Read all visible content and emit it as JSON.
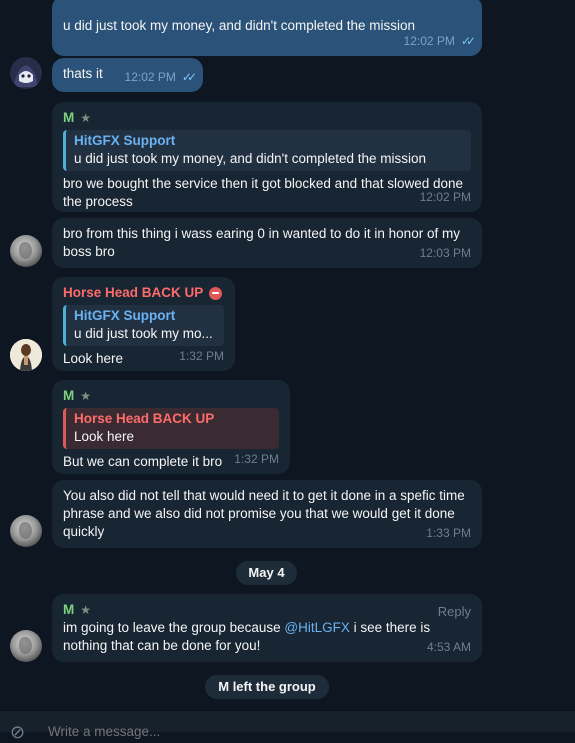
{
  "messages": [
    {
      "text": "u did just took my money, and didn't completed the mission",
      "time": "12:02 PM"
    },
    {
      "text": "thats it",
      "time": "12:02 PM"
    },
    {
      "sender": "M",
      "quote": {
        "name": "HitGFX Support",
        "text": "u did just took my money, and didn't completed the mission"
      },
      "text": "bro we bought the service then it got blocked and that slowed done the process",
      "time": "12:02 PM"
    },
    {
      "text": "bro from this thing i wass earing 0 in wanted to do it in honor of my boss bro",
      "time": "12:03 PM"
    },
    {
      "sender": "Horse Head BACK UP",
      "quote": {
        "name": "HitGFX Support",
        "text": "u did just took my mo..."
      },
      "text": "Look here",
      "time": "1:32 PM"
    },
    {
      "sender": "M",
      "quote": {
        "name": "Horse Head BACK UP",
        "text": "Look here"
      },
      "text": "But we can complete it bro",
      "time": "1:32 PM"
    },
    {
      "text": "You also did not tell that would need it to get it done in a spefic time phrase and we also did not promise you that we would get it done quickly",
      "time": "1:33 PM"
    },
    {
      "sender": "M",
      "reply_label": "Reply",
      "text_before": "im going to leave the group because ",
      "mention": "@HitLGFX",
      "text_after": " i see there  is nothing that can be done for you!",
      "time": "4:53 AM"
    }
  ],
  "date_separator": "May 4",
  "service_message": "M left the group",
  "composer": {
    "placeholder": "Write a message..."
  },
  "colors": {
    "background": "#0e1621",
    "incoming": "#182533",
    "outgoing": "#2b5278",
    "sender_green": "#7ed27e",
    "sender_red": "#ff6b6b",
    "link": "#6ab2f2"
  },
  "icons": {
    "read_receipt": "double-check-icon",
    "admin": "star-icon",
    "status": "no-entry-icon",
    "attach": "paperclip-icon"
  }
}
